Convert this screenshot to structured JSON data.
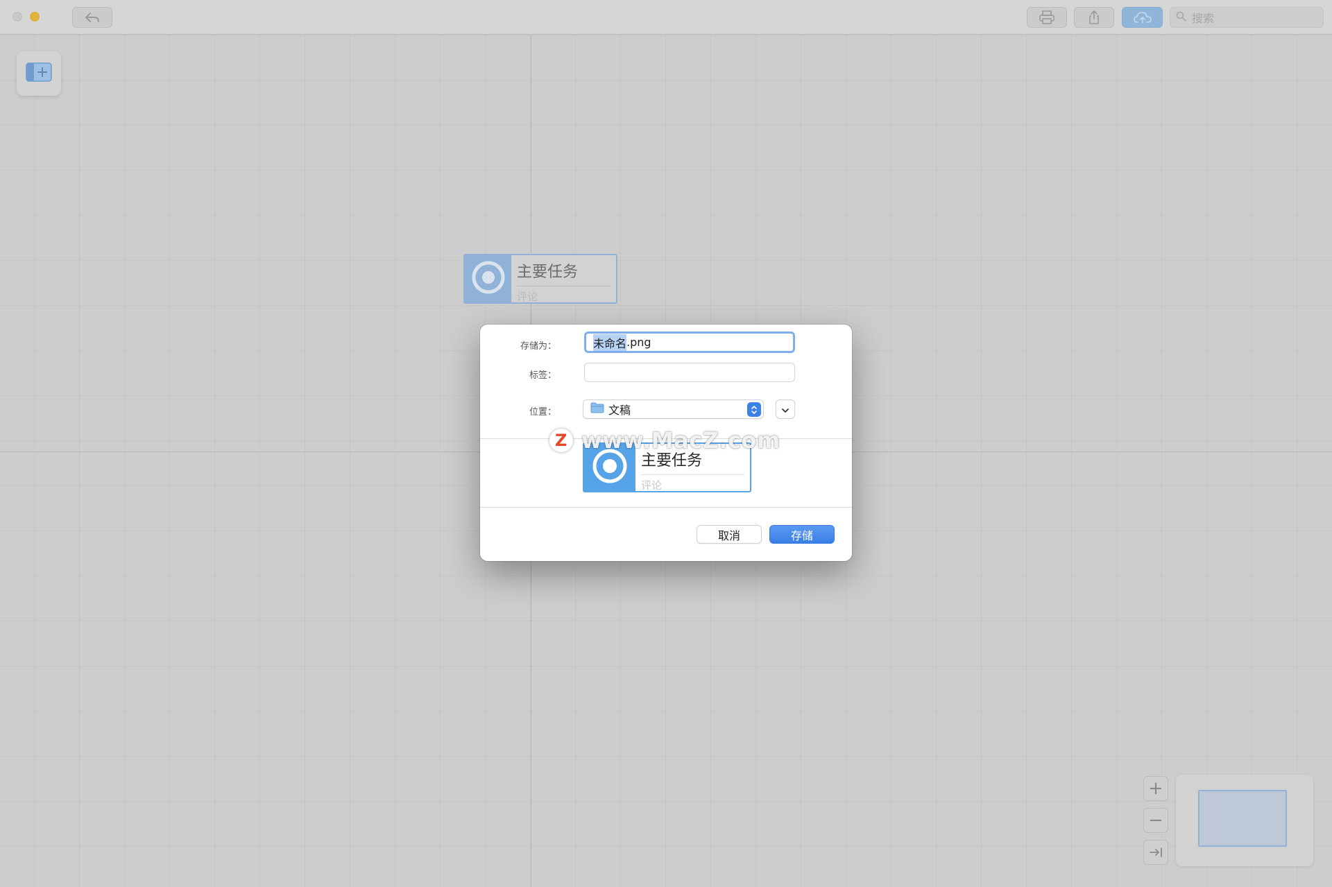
{
  "toolbar": {
    "search_placeholder": "搜索"
  },
  "canvas": {
    "node": {
      "title": "主要任务",
      "comment": "评论"
    }
  },
  "dialog": {
    "save_as_label": "存储为：",
    "filename_selected": "未命名",
    "filename_ext": ".png",
    "tags_label": "标签：",
    "tags_value": "",
    "location_label": "位置：",
    "location_value": "文稿",
    "preview": {
      "title": "主要任务",
      "comment": "评论"
    },
    "watermark": "www.MacZ.com",
    "watermark_logo": "Z",
    "cancel_label": "取消",
    "save_label": "存储"
  },
  "zoom": {
    "in_symbol": "+",
    "out_symbol": "−"
  },
  "colors": {
    "accent": "#3b82e6",
    "node_blue": "#57a3e8",
    "node_blue_dim": "#8fb2d6"
  }
}
